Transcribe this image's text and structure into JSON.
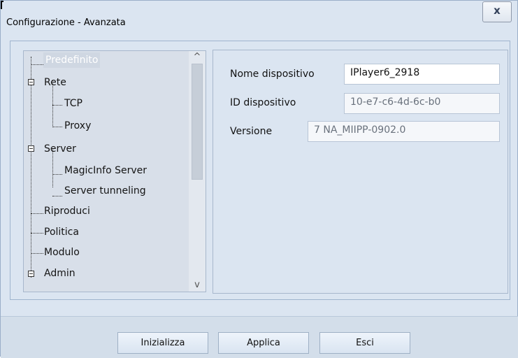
{
  "window": {
    "title": "Configurazione - Avanzata",
    "close_label": "x"
  },
  "tree": {
    "items": [
      {
        "label": "Predefinito"
      },
      {
        "label": "Rete"
      },
      {
        "label": "TCP"
      },
      {
        "label": "Proxy"
      },
      {
        "label": "Server"
      },
      {
        "label": "MagicInfo Server"
      },
      {
        "label": "Server tunneling"
      },
      {
        "label": "Riproduci"
      },
      {
        "label": "Politica"
      },
      {
        "label": "Modulo"
      },
      {
        "label": "Admin"
      }
    ]
  },
  "scrollbar": {
    "up_label": "^",
    "down_label": "v"
  },
  "form": {
    "device_name_label": "Nome dispositivo",
    "device_name_value": "IPlayer6_2918",
    "device_id_label": "ID dispositivo",
    "device_id_value": "10-e7-c6-4d-6c-b0",
    "version_label": "Versione",
    "version_value": "7 NA_MIIPP-0902.0"
  },
  "buttons": {
    "initialize": "Inizializza",
    "apply": "Applica",
    "exit": "Esci"
  }
}
